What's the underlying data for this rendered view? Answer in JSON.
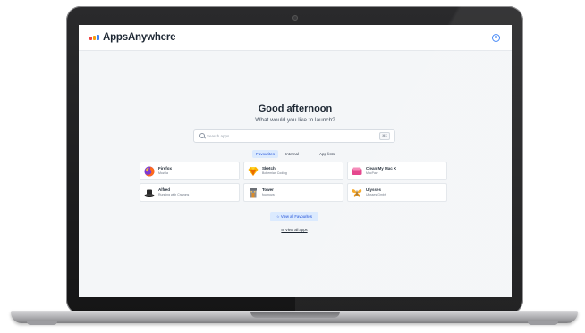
{
  "app": {
    "name": "AppsAnywhere",
    "brand_colors": [
      "#ef4444",
      "#f59e0b",
      "#3b82f6"
    ],
    "icons": {
      "logo": "logo-bars-icon",
      "user": "user-circle-icon",
      "search": "search-icon"
    }
  },
  "hero": {
    "greeting": "Good afternoon",
    "subtitle": "What would you like to launch?"
  },
  "search": {
    "placeholder": "Search apps",
    "shortcut": "⌘K"
  },
  "tabs": [
    {
      "label": "Favourites",
      "active": true
    },
    {
      "label": "Internal",
      "active": false
    },
    {
      "label": "App lists",
      "active": false
    }
  ],
  "apps": [
    {
      "name": "Firefox",
      "publisher": "Mozilla",
      "icon": "firefox-icon"
    },
    {
      "name": "Sketch",
      "publisher": "Bohemian Coding",
      "icon": "sketch-icon"
    },
    {
      "name": "Clean My Mac X",
      "publisher": "MacPaw",
      "icon": "cleanmymac-icon"
    },
    {
      "name": "Alfred",
      "publisher": "Running with Crayons",
      "icon": "alfred-icon"
    },
    {
      "name": "Tower",
      "publisher": "fournova",
      "icon": "tower-icon"
    },
    {
      "name": "Ulysses",
      "publisher": "Ulysses GmbH",
      "icon": "ulysses-icon"
    }
  ],
  "actions": {
    "view_favourites": "☆ View all Favourites",
    "view_all_apps": "⊞ View all apps"
  }
}
